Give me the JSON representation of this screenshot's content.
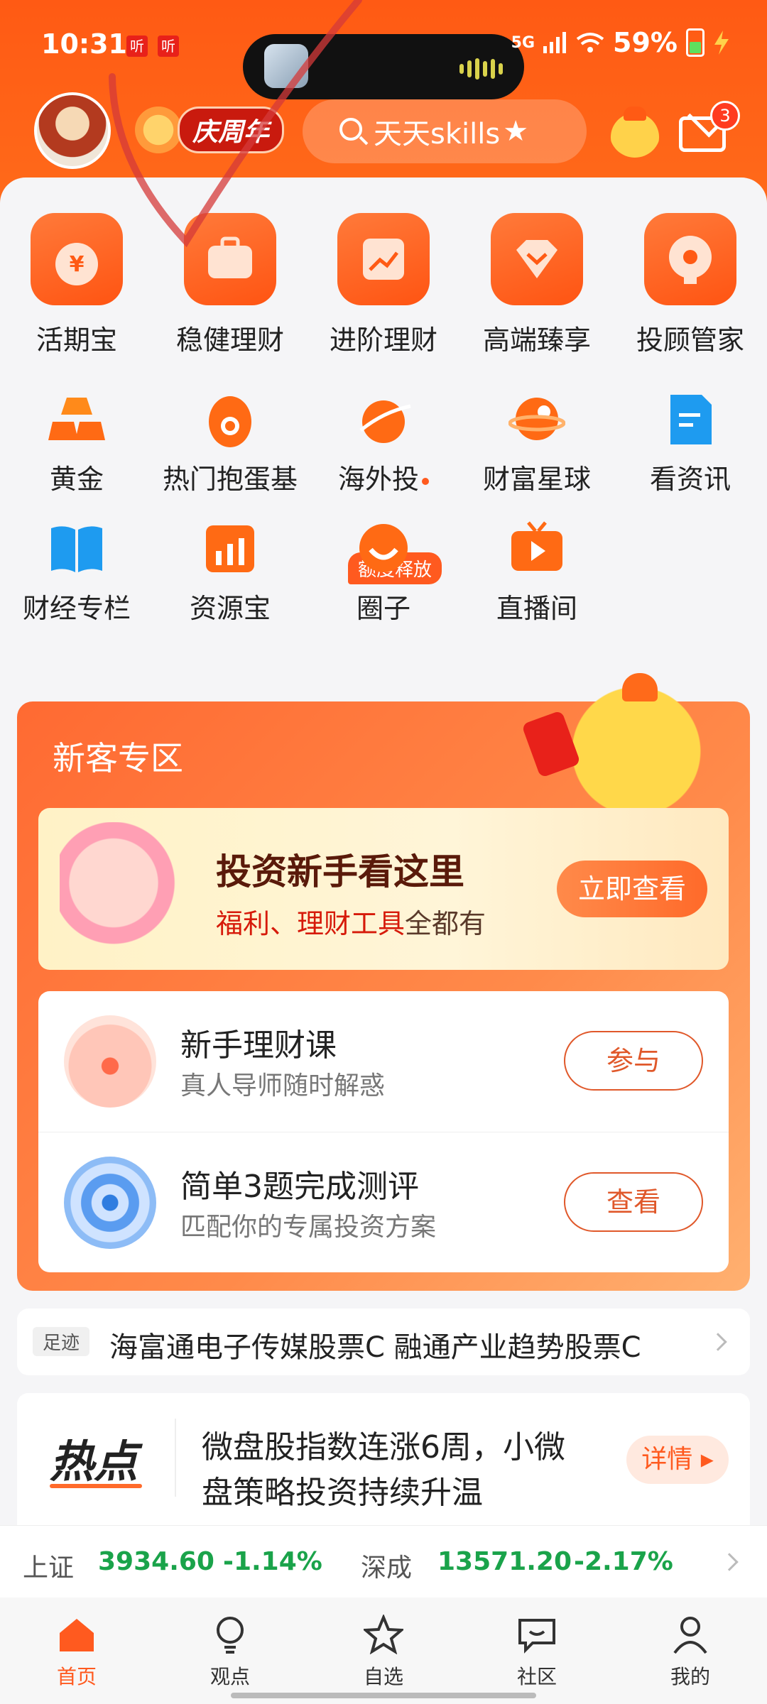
{
  "status": {
    "time": "10:31",
    "badges": [
      "听",
      "听"
    ],
    "network": "5G",
    "battery": "59%"
  },
  "top": {
    "anniversary": "庆周年",
    "search_text": "天天skills",
    "mail_count": "3"
  },
  "grid": {
    "row1": [
      {
        "label": "活期宝",
        "icon": "money-bag-icon"
      },
      {
        "label": "稳健理财",
        "icon": "briefcase-icon"
      },
      {
        "label": "进阶理财",
        "icon": "trend-chart-icon"
      },
      {
        "label": "高端臻享",
        "icon": "diamond-icon"
      },
      {
        "label": "投顾管家",
        "icon": "advisor-icon"
      }
    ],
    "row2": [
      {
        "label": "黄金",
        "icon": "gold-bars-icon"
      },
      {
        "label": "热门抱蛋基",
        "icon": "egg-icon"
      },
      {
        "label": "海外投",
        "icon": "planet-icon"
      },
      {
        "label": "财富星球",
        "icon": "wealth-planet-icon"
      },
      {
        "label": "看资讯",
        "icon": "news-icon"
      }
    ],
    "row3": [
      {
        "label": "财经专栏",
        "icon": "book-icon"
      },
      {
        "label": "资源宝",
        "icon": "bar-chart-icon"
      },
      {
        "label": "圈子",
        "icon": "circle-community-icon"
      },
      {
        "label": "直播间",
        "icon": "live-tv-icon"
      }
    ],
    "overseas_tag": "额度释放"
  },
  "newbie": {
    "title": "新客专区",
    "banner_title": "投资新手看这里",
    "banner_sub_red": "福利、理财工具",
    "banner_sub": "全都有",
    "banner_button": "立即查看",
    "items": [
      {
        "title": "新手理财课",
        "desc": "真人导师随时解惑",
        "button": "参与"
      },
      {
        "title": "简单3题完成测评",
        "desc": "匹配你的专属投资方案",
        "button": "查看"
      }
    ]
  },
  "track": {
    "tag": "足迹",
    "text": "海富通电子传媒股票C 融通产业趋势股票C"
  },
  "hot": {
    "logo": "热点",
    "line1": "微盘股指数连涨6周，小微",
    "line2": "盘策略投资持续升温",
    "button": "详情"
  },
  "ticker": {
    "sh_name": "上证",
    "sh_value": "3934.60",
    "sh_change": "-1.14%",
    "sz_name": "深成",
    "sz_value": "13571.20",
    "sz_change": "-2.17%"
  },
  "tabs": [
    "首页",
    "观点",
    "自选",
    "社区",
    "我的"
  ],
  "colors": {
    "brand": "#ff5a14",
    "down": "#1aa34a"
  }
}
